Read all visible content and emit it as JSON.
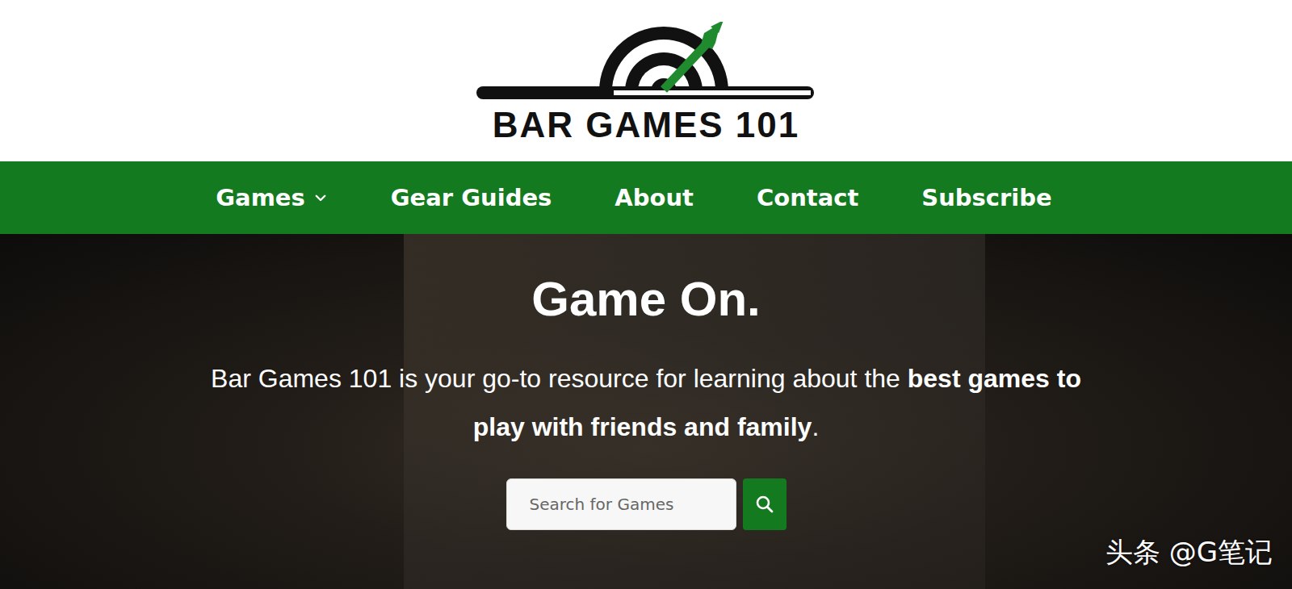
{
  "header": {
    "logo_text": "BAR GAMES 101"
  },
  "nav": {
    "items": [
      {
        "label": "Games",
        "kind": "dropdown"
      },
      {
        "label": "Gear Guides",
        "kind": "link"
      },
      {
        "label": "About",
        "kind": "link"
      },
      {
        "label": "Contact",
        "kind": "link"
      },
      {
        "label": "Subscribe",
        "kind": "link"
      }
    ]
  },
  "hero": {
    "title": "Game On.",
    "paragraph": [
      {
        "text": "Bar Games 101 is your go-to resource for learning about the ",
        "bold": false
      },
      {
        "text": "best games to play with friends and family",
        "bold": true
      },
      {
        "text": ".",
        "bold": false
      }
    ],
    "search": {
      "placeholder": "Search for Games"
    }
  },
  "watermark": "头条 @G笔记"
}
